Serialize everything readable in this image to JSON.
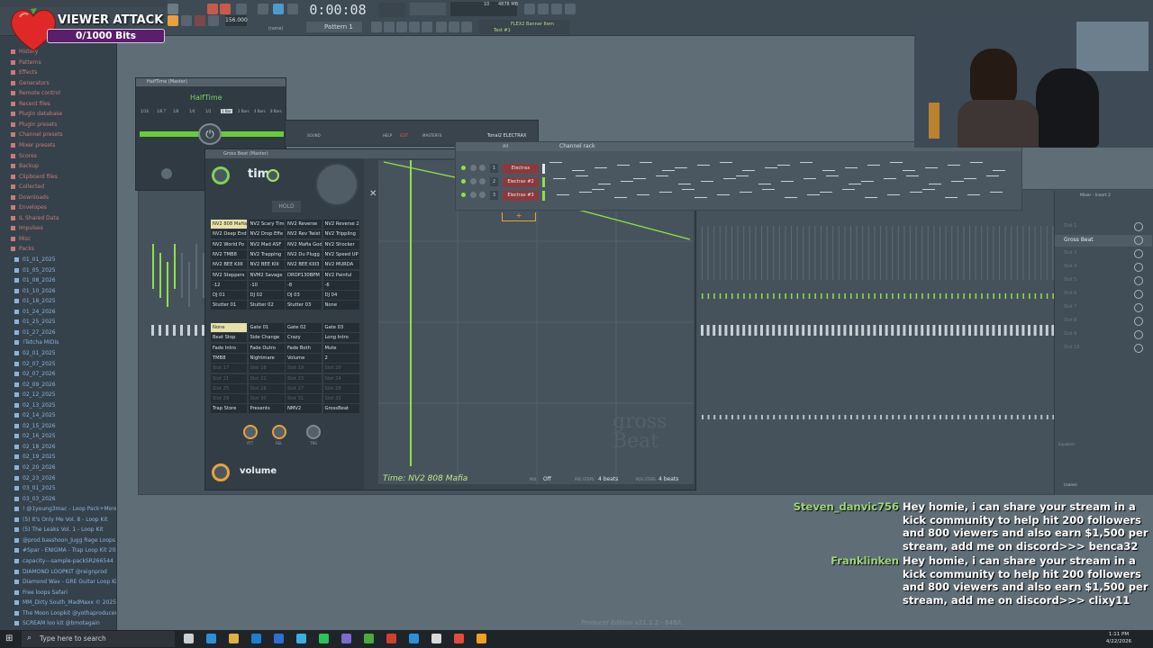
{
  "toolbar": {
    "time_display": "0:00:08",
    "pattern_label": "Pattern 1",
    "tempo": "156.000",
    "hint_title": "FLEX2 Banner Item",
    "hint_sub": "Test #1",
    "none_label": "(none)",
    "cpu_value": "4878 MB",
    "cpu_count": "10"
  },
  "overlay": {
    "title": "VIEWER ATTACK",
    "progress_text": "0/1000 Bits",
    "progress": 0
  },
  "browser": {
    "items": [
      {
        "label": "History",
        "color": "#c97a7a"
      },
      {
        "label": "Patterns",
        "color": "#c97a7a"
      },
      {
        "label": "Effects",
        "color": "#c97a7a"
      },
      {
        "label": "Generators",
        "color": "#c97a7a"
      },
      {
        "label": "Remote control",
        "color": "#c97a7a"
      },
      {
        "label": "Recent files",
        "color": "#c97a7a"
      },
      {
        "label": "Plugin database",
        "color": "#c97a7a"
      },
      {
        "label": "Plugin presets",
        "color": "#c97a7a"
      },
      {
        "label": "Channel presets",
        "color": "#c97a7a"
      },
      {
        "label": "Mixer presets",
        "color": "#c97a7a"
      },
      {
        "label": "Scores",
        "color": "#c97a7a"
      },
      {
        "label": "Backup",
        "color": "#c97a7a"
      },
      {
        "label": "Clipboard files",
        "color": "#c97a7a"
      },
      {
        "label": "Collected",
        "color": "#c97a7a"
      },
      {
        "label": "Downloads",
        "color": "#c97a7a"
      },
      {
        "label": "Envelopes",
        "color": "#c97a7a"
      },
      {
        "label": "IL Shared Data",
        "color": "#c97a7a"
      },
      {
        "label": "Impulses",
        "color": "#c97a7a"
      },
      {
        "label": "Misc",
        "color": "#c97a7a"
      },
      {
        "label": "Packs",
        "color": "#c97a7a"
      },
      {
        "label": "01_01_2025",
        "color": "#8fb2d9"
      },
      {
        "label": "01_05_2025",
        "color": "#8fb2d9"
      },
      {
        "label": "01_08_2026",
        "color": "#8fb2d9"
      },
      {
        "label": "01_10_2026",
        "color": "#8fb2d9"
      },
      {
        "label": "01_18_2025",
        "color": "#8fb2d9"
      },
      {
        "label": "01_24_2026",
        "color": "#8fb2d9"
      },
      {
        "label": "01_25_2025",
        "color": "#8fb2d9"
      },
      {
        "label": "01_27_2026",
        "color": "#8fb2d9"
      },
      {
        "label": "!Tetcha MIDIs",
        "color": "#8fb2d9"
      },
      {
        "label": "02_01_2025",
        "color": "#8fb2d9"
      },
      {
        "label": "02_07_2025",
        "color": "#8fb2d9"
      },
      {
        "label": "02_07_2026",
        "color": "#8fb2d9"
      },
      {
        "label": "02_09_2026",
        "color": "#8fb2d9"
      },
      {
        "label": "02_12_2025",
        "color": "#8fb2d9"
      },
      {
        "label": "02_13_2025",
        "color": "#8fb2d9"
      },
      {
        "label": "02_14_2025",
        "color": "#8fb2d9"
      },
      {
        "label": "02_15_2026",
        "color": "#8fb2d9"
      },
      {
        "label": "02_16_2025",
        "color": "#8fb2d9"
      },
      {
        "label": "02_18_2026",
        "color": "#8fb2d9"
      },
      {
        "label": "02_19_2025",
        "color": "#8fb2d9"
      },
      {
        "label": "02_20_2026",
        "color": "#8fb2d9"
      },
      {
        "label": "02_23_2026",
        "color": "#8fb2d9"
      },
      {
        "label": "03_01_2025",
        "color": "#8fb2d9"
      },
      {
        "label": "03_03_2026",
        "color": "#8fb2d9"
      },
      {
        "label": "! @1young3mac - Loop Pack+More !",
        "color": "#8fb2d9"
      },
      {
        "label": "(5) It's Only Me Vol. 8 - Loop Kit",
        "color": "#8fb2d9"
      },
      {
        "label": "(5) The Leaks Vol. 1 - Loop Kit",
        "color": "#8fb2d9"
      },
      {
        "label": "@prod.basshoon_Jugg Rage Loops",
        "color": "#8fb2d9"
      },
      {
        "label": "#Spar - ENIGMA - Trap Loop Kit 2026",
        "color": "#8fb2d9"
      },
      {
        "label": "capacity---sample-packSR266544",
        "color": "#8fb2d9"
      },
      {
        "label": "DIAMOND LOOPKIT @reignprod",
        "color": "#8fb2d9"
      },
      {
        "label": "Diamond Wav - GRE Guitar Loop Kit",
        "color": "#8fb2d9"
      },
      {
        "label": "Free loops Safari",
        "color": "#8fb2d9"
      },
      {
        "label": "MM_Dirty South_MadMaxx © 2025",
        "color": "#8fb2d9"
      },
      {
        "label": "The Moon Loopkit @yothaproducer",
        "color": "#8fb2d9"
      },
      {
        "label": "SCREAM loo kit @bmotagain",
        "color": "#8fb2d9"
      }
    ]
  },
  "halftime": {
    "title": "HalfTime (Master)",
    "brand": "HalfTime",
    "rate_options": [
      "1/16",
      "1/8 T",
      "1/8",
      "1/4",
      "1/2",
      "1 Bar",
      "2 Bars",
      "4 Bars",
      "8 Bars"
    ],
    "selected_rate": "1 Bar"
  },
  "grossbeat": {
    "title": "Gross Beat (Master)",
    "time_label": "time",
    "volume_label": "volume",
    "hold_label": "HOLD",
    "status": "Time: NV2 808 Mafia",
    "mix_label": "MIX",
    "mix_value": "Off",
    "pre_label": "PRE STEPS",
    "pre_value": "4 beats",
    "pos_label": "POS STEPS",
    "pos_value": "4 beats",
    "watermark": "gross Beat",
    "time_presets": [
      "NV2 808 Mafia",
      "NV2 Scary Tim",
      "NV2 Reverse",
      "NV2 Reverse 2",
      "NV2 Deep End",
      "NV2 Drop Effe",
      "NV2 Rev Twist",
      "NV2 Trippling",
      "NV2 World Po",
      "NV2 Mad ASF",
      "NV2 Mafia God",
      "NV2 Shocker",
      "NV2 TMB8",
      "NV2 Trapping",
      "NV2 Du Plugg",
      "NV2 Speed UP",
      "NV2 BEE KIIII",
      "NV2 BEE KIII",
      "NV2 BEE KIII3",
      "NV2 MURDA",
      "NV2 Steppers",
      "NVM2 Savage",
      "DROP130BPM",
      "NV2 Painful",
      "-12",
      "-10",
      "-8",
      "-6",
      "DJ 01",
      "DJ 02",
      "DJ 03",
      "DJ 04",
      "Stutter 01",
      "Stutter 02",
      "Stutter 03",
      "None"
    ],
    "volume_presets": [
      "None",
      "Gate 01",
      "Gate 02",
      "Gate 03",
      "Beat Stop",
      "Side Change",
      "Crazy",
      "Long Intro",
      "Fade Intro",
      "Fade Outro",
      "Fade Both",
      "Mute",
      "TMB8",
      "Nightmare",
      "Volume",
      "2",
      "Slot 17",
      "Slot 18",
      "Slot 19",
      "Slot 20",
      "Slot 21",
      "Slot 22",
      "Slot 23",
      "Slot 24",
      "Slot 25",
      "Slot 26",
      "Slot 27",
      "Slot 28",
      "Slot 29",
      "Slot 30",
      "Slot 31",
      "Slot 32",
      "Trap Store",
      "Presents",
      "NMV2",
      "GrossBeat"
    ],
    "knob_labels": [
      "ATT",
      "REL",
      "TNS"
    ]
  },
  "tonal_window": {
    "title": "Tonal2 ELECTRAX",
    "tabs": [
      "SOUND",
      "HELP",
      "EDIT",
      "MASTERFX"
    ]
  },
  "channel_rack": {
    "title": "Channel rack",
    "filter": "All",
    "channels": [
      {
        "num": "1",
        "name": "Electrax"
      },
      {
        "num": "2",
        "name": "Electrax #2"
      },
      {
        "num": "3",
        "name": "Electrax #3"
      }
    ]
  },
  "insert": {
    "title": "Mixer - Insert 2",
    "slots": [
      "Slot 1",
      "Gross Beat",
      "Slot 3",
      "Slot 4",
      "Slot 5",
      "Slot 6",
      "Slot 7",
      "Slot 8",
      "Slot 9",
      "Slot 10"
    ],
    "equalizer": "Equalizer",
    "out_none": "(none)"
  },
  "chat": [
    {
      "user": "Steven_danvic756",
      "user_color": "#9ed57a",
      "message": "Hey homie, i can share your stream in a kick community to help hit 200 followers and 800 viewers and also earn $1,500 per stream, add me on discord>>> benca32"
    },
    {
      "user": "Franklinken",
      "user_color": "#9ed57a",
      "message": "Hey homie, i can share your stream in a kick community to help hit 200 followers and 800 viewers and also earn $1,500 per stream, add me on discord>>> clixy11"
    }
  ],
  "footer": {
    "edition": "Producer Edition v21.1.2 - 64Bit"
  },
  "taskbar": {
    "search_placeholder": "Type here to search",
    "time": "1:11 PM",
    "date": "4/22/2026"
  },
  "colors": {
    "accent_green": "#8fe04a",
    "overlay_purple": "#5a1e6a",
    "heart_red": "#e02828"
  }
}
